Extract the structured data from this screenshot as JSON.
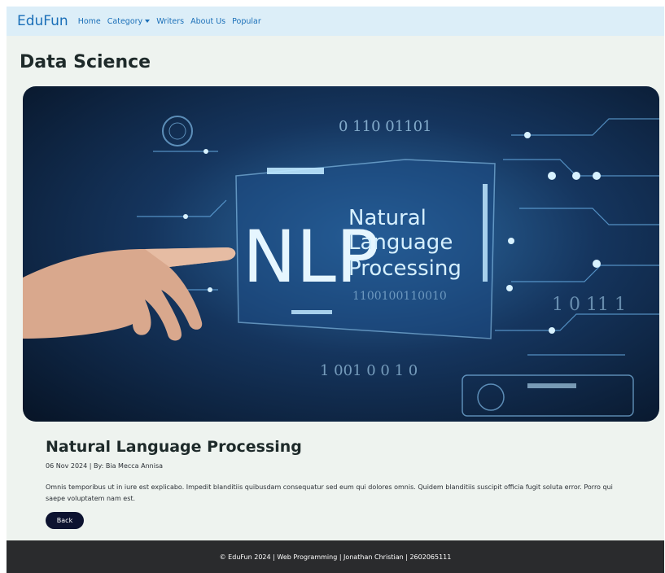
{
  "navbar": {
    "brand": "EduFun",
    "links": [
      "Home",
      "Category",
      "Writers",
      "About Us",
      "Popular"
    ]
  },
  "page_title": "Data Science",
  "hero_image": {
    "text_nlp": "NLP",
    "text_line1": "Natural",
    "text_line2": "Language",
    "text_line3": "Processing",
    "binary_top": "0 110  01101",
    "binary_mid": "1100100110010",
    "binary_bottom": "1 001 0   0 1 0",
    "side_digits": "1 0  11  1"
  },
  "article": {
    "title": "Natural Language Processing",
    "meta": "06 Nov 2024 | By: Bia Mecca Annisa",
    "body": "Omnis temporibus ut in iure est explicabo. Impedit blanditiis quibusdam consequatur sed eum qui dolores omnis. Quidem blanditiis suscipit officia fugit soluta error. Porro qui saepe voluptatem nam est.",
    "back_label": "Back"
  },
  "footer": {
    "text": "© EduFun 2024 | Web Programming | Jonathan Christian | 2602065111"
  },
  "colors": {
    "navbar_bg": "#dceef8",
    "link": "#1a6fb8",
    "page_bg": "#eef3ef",
    "footer_bg": "#2a2b2d",
    "button_bg": "#0d1330"
  }
}
